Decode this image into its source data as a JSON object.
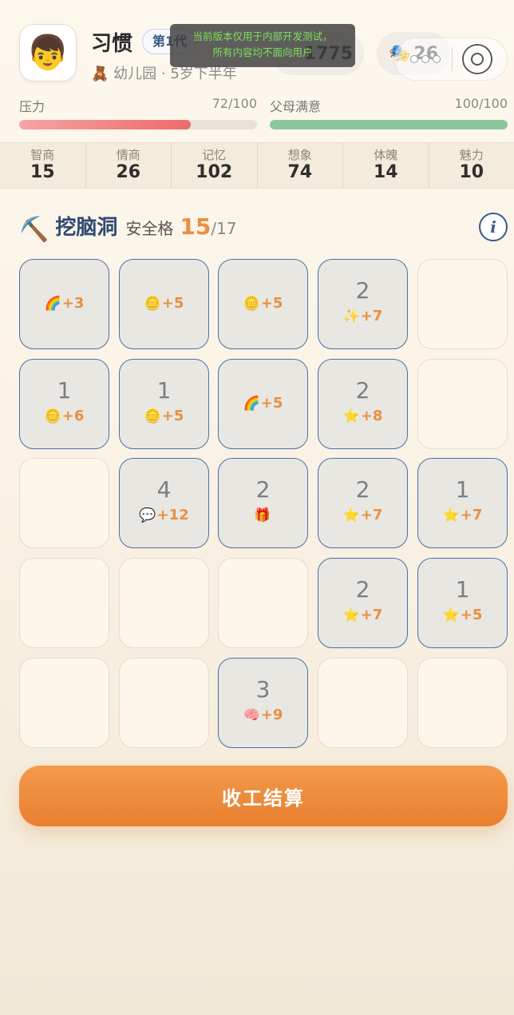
{
  "header": {
    "avatar_emoji": "👦",
    "name": "习惯",
    "generation_badge": "第1代",
    "stage_icon": "🧸",
    "stage_text": "幼儿园 · 5岁下半年",
    "coins": "1775",
    "masks_icon": "🎭",
    "masks": "26",
    "dev_notice_line1": "当前版本仅用于内部开发测试，",
    "dev_notice_line2": "所有内容均不面向用户"
  },
  "meters": {
    "pressure": {
      "label": "压力",
      "value_text": "72/100",
      "fraction": 0.72,
      "color": "#ee6b6b"
    },
    "parents": {
      "label": "父母满意",
      "value_text": "100/100",
      "fraction": 1.0,
      "color": "#8cc79b"
    }
  },
  "stats": [
    {
      "label": "智商",
      "value": "15"
    },
    {
      "label": "情商",
      "value": "26"
    },
    {
      "label": "记忆",
      "value": "102"
    },
    {
      "label": "想象",
      "value": "74"
    },
    {
      "label": "体魄",
      "value": "14"
    },
    {
      "label": "魅力",
      "value": "10"
    }
  ],
  "section": {
    "pick_icon": "⛏️",
    "title": "挖脑洞",
    "safe_label": "安全格",
    "safe_found": "15",
    "safe_total": "/17",
    "info_label": "i"
  },
  "grid": [
    [
      {
        "open": true,
        "num": "",
        "icon": "🌈",
        "reward": "+3"
      },
      {
        "open": true,
        "num": "",
        "icon": "🪙",
        "reward": "+5"
      },
      {
        "open": true,
        "num": "",
        "icon": "🪙",
        "reward": "+5"
      },
      {
        "open": true,
        "num": "2",
        "icon": "✨",
        "reward": "+7"
      },
      {
        "open": false
      }
    ],
    [
      {
        "open": true,
        "num": "1",
        "icon": "🪙",
        "reward": "+6"
      },
      {
        "open": true,
        "num": "1",
        "icon": "🪙",
        "reward": "+5"
      },
      {
        "open": true,
        "num": "",
        "icon": "🌈",
        "reward": "+5"
      },
      {
        "open": true,
        "num": "2",
        "icon": "⭐",
        "reward": "+8"
      },
      {
        "open": false
      }
    ],
    [
      {
        "open": false
      },
      {
        "open": true,
        "num": "4",
        "icon": "💬",
        "reward": "+12"
      },
      {
        "open": true,
        "num": "2",
        "icon": "🎁",
        "reward": ""
      },
      {
        "open": true,
        "num": "2",
        "icon": "⭐",
        "reward": "+7"
      },
      {
        "open": true,
        "num": "1",
        "icon": "⭐",
        "reward": "+7"
      }
    ],
    [
      {
        "open": false
      },
      {
        "open": false
      },
      {
        "open": false
      },
      {
        "open": true,
        "num": "2",
        "icon": "⭐",
        "reward": "+7"
      },
      {
        "open": true,
        "num": "1",
        "icon": "⭐",
        "reward": "+5"
      }
    ],
    [
      {
        "open": false
      },
      {
        "open": false
      },
      {
        "open": true,
        "num": "3",
        "icon": "🧠",
        "reward": "+9"
      },
      {
        "open": false
      },
      {
        "open": false
      }
    ]
  ],
  "settle_button": "收工结算"
}
